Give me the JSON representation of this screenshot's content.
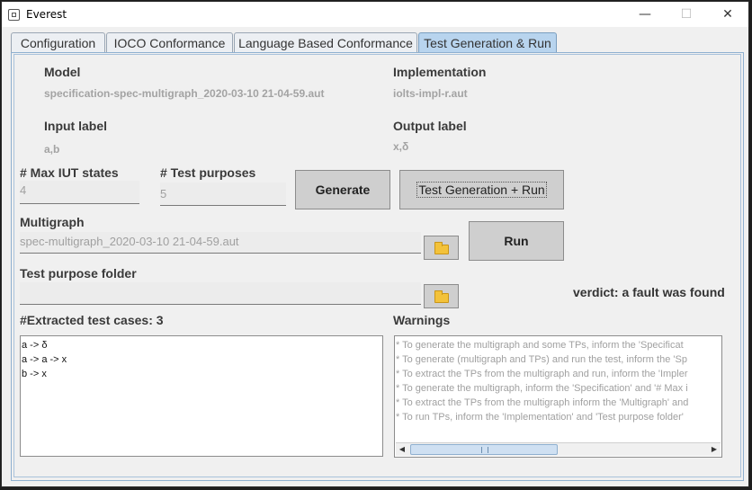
{
  "window": {
    "title": "Everest",
    "minimize": "—",
    "maximize": "☐",
    "close": "✕"
  },
  "tabs": [
    {
      "label": "Configuration"
    },
    {
      "label": "IOCO Conformance"
    },
    {
      "label": "Language Based Conformance"
    },
    {
      "label": "Test Generation & Run",
      "active": true
    }
  ],
  "form": {
    "model_label": "Model",
    "model_value": "specification-spec-multigraph_2020-03-10 21-04-59.aut",
    "implementation_label": "Implementation",
    "implementation_value": "iolts-impl-r.aut",
    "input_label_label": "Input label",
    "input_label_value": "a,b",
    "output_label_label": "Output label",
    "output_label_value": "x,δ",
    "max_iut_states_label": "# Max IUT states",
    "max_iut_states_value": "4",
    "test_purposes_label": "#  Test purposes",
    "test_purposes_value": "5",
    "generate_button": "Generate",
    "test_gen_run_button": "Test Generation  + Run",
    "multigraph_label": "Multigraph",
    "multigraph_value": "spec-multigraph_2020-03-10 21-04-59.aut",
    "run_button": "Run",
    "test_purpose_folder_label": "Test purpose folder",
    "test_purpose_folder_value": "",
    "verdict_text": "verdict:  a fault was found",
    "extracted_label": "#Extracted test cases: 3",
    "warnings_label": "Warnings"
  },
  "extracted_test_cases": [
    "a -> δ",
    "a -> a -> x",
    "b -> x"
  ],
  "warnings": [
    "* To generate the multigraph and some TPs,  inform the 'Specificat",
    "* To generate (multigraph and TPs) and run the test,  inform the 'Sp",
    "* To extract the TPs from the multigraph and run,  inform the 'Impler",
    "* To generate the multigraph,  inform the 'Specification' and '# Max i",
    "* To extract the TPs from the multigraph  inform the 'Multigraph' and",
    "* To run TPs,  inform the 'Implementation' and 'Test purpose folder'"
  ],
  "icons": {
    "folder": "folder-icon",
    "app": "app-icon"
  },
  "colors": {
    "active_tab": "#b8d4ee",
    "folder": "#f3c23a"
  }
}
